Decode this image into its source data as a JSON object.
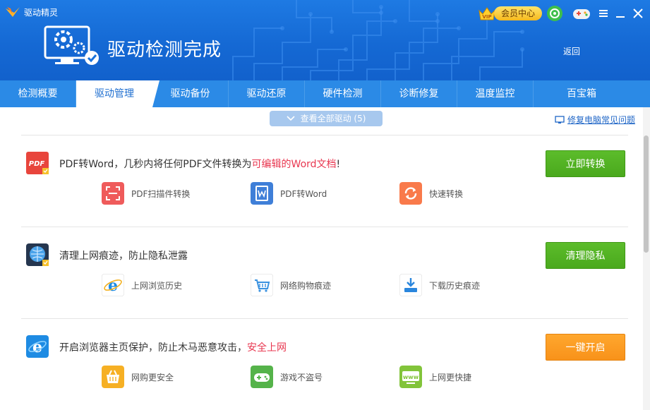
{
  "app": {
    "title": "驱动精灵"
  },
  "header": {
    "page_title": "驱动检测完成",
    "back_label": "返回",
    "vip_label": "会员中心",
    "vip_badge_text": "VIP",
    "controls": [
      "shield-icon",
      "gamepad-icon",
      "menu-icon",
      "minimize-icon",
      "close-icon"
    ]
  },
  "tabs": [
    "检测概要",
    "驱动管理",
    "驱动备份",
    "驱动还原",
    "硬件检测",
    "诊断修复",
    "温度监控",
    "百宝箱"
  ],
  "active_tab": "驱动管理",
  "toolbar": {
    "view_all_label": "查看全部驱动 (5)",
    "fix_link_label": "修复电脑常见问题"
  },
  "sections": [
    {
      "icon": "pdf-icon",
      "icon_text": "PDF",
      "title_prefix": "PDF转Word，几秒内将任何PDF文件转换为",
      "title_highlight": "可编辑的Word文档",
      "title_suffix": "!",
      "button_label": "立即转换",
      "button_color": "#52b323",
      "features": [
        {
          "label": "PDF扫描件转换",
          "icon": "scan-icon",
          "color": "#ef5b5b"
        },
        {
          "label": "PDF转Word",
          "icon": "word-doc-icon",
          "color": "#3f7fd8"
        },
        {
          "label": "快速转换",
          "icon": "refresh-icon",
          "color": "#f97a4b"
        }
      ]
    },
    {
      "icon": "privacy-clean-icon",
      "title_prefix": "清理上网痕迹，防止隐私泄露",
      "title_highlight": "",
      "title_suffix": "",
      "button_label": "清理隐私",
      "button_color": "#52b323",
      "features": [
        {
          "label": "上网浏览历史",
          "icon": "ie-browser-icon",
          "color": "#1e8be3"
        },
        {
          "label": "网络购物痕迹",
          "icon": "shopping-cart-icon",
          "color": "#3a92e0"
        },
        {
          "label": "下载历史痕迹",
          "icon": "download-icon",
          "color": "#2a86dd"
        }
      ]
    },
    {
      "icon": "ie-shield-icon",
      "title_prefix": "开启浏览器主页保护，防止木马恶意攻击，",
      "title_highlight": "安全上网",
      "title_suffix": "",
      "button_label": "一键开启",
      "button_color": "#f9971f",
      "features": [
        {
          "label": "网购更安全",
          "icon": "basket-icon",
          "color": "#f6b024"
        },
        {
          "label": "游戏不盗号",
          "icon": "gamepad-icon",
          "color": "#55b34a"
        },
        {
          "label": "上网更快捷",
          "icon": "www-icon",
          "color": "#82c43a"
        }
      ]
    }
  ],
  "colors": {
    "header_blue": "#1569d4",
    "tab_blue": "#2b8ae6",
    "link_blue": "#1f66c7",
    "highlight_red": "#e8364f"
  }
}
